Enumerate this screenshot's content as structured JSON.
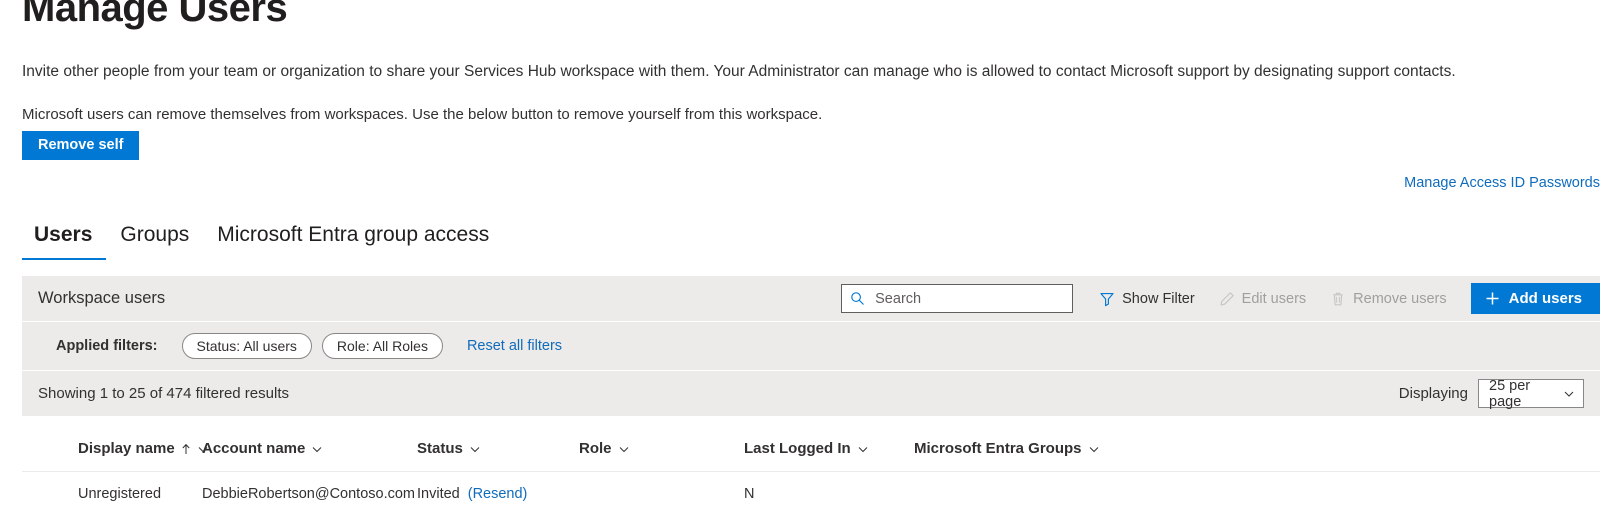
{
  "page": {
    "title": "Manage Users",
    "intro_line_1": "Invite other people from your team or organization to share your Services Hub workspace with them. Your Administrator can manage who is allowed to contact Microsoft support by designating support contacts.",
    "intro_line_2": "Microsoft users can remove themselves from workspaces. Use the below button to remove yourself from this workspace.",
    "remove_self_label": "Remove self",
    "access_link_label": "Manage Access ID Passwords"
  },
  "tabs": [
    {
      "label": "Users",
      "active": true
    },
    {
      "label": "Groups",
      "active": false
    },
    {
      "label": "Microsoft Entra group access",
      "active": false
    }
  ],
  "toolbar": {
    "heading": "Workspace users",
    "search_placeholder": "Search",
    "search_value": "",
    "show_filter_label": "Show Filter",
    "edit_users_label": "Edit users",
    "remove_users_label": "Remove users",
    "add_users_label": "Add users"
  },
  "filters": {
    "label": "Applied filters:",
    "pills": [
      {
        "label": "Status: All users"
      },
      {
        "label": "Role: All Roles"
      }
    ],
    "reset_label": "Reset all filters"
  },
  "results": {
    "showing_text": "Showing 1 to 25 of 474 filtered results",
    "displaying_label": "Displaying",
    "per_page_value": "25 per page"
  },
  "table": {
    "columns": [
      {
        "label": "Display name",
        "sorted": "asc"
      },
      {
        "label": "Account name",
        "sorted": ""
      },
      {
        "label": "Status",
        "sorted": ""
      },
      {
        "label": "Role",
        "sorted": ""
      },
      {
        "label": "Last Logged In",
        "sorted": ""
      },
      {
        "label": "Microsoft Entra Groups",
        "sorted": ""
      }
    ],
    "rows": [
      {
        "display_name": "Unregistered",
        "account_name": "DebbieRobertson@Contoso.com",
        "status": "Invited",
        "status_action": "(Resend)",
        "role": "",
        "last_logged_in": "N",
        "entra_groups": ""
      }
    ]
  },
  "colors": {
    "accent": "#0078d4",
    "link": "#0f6cbd",
    "panel_bg": "#edebe9",
    "text": "#323130",
    "disabled": "#a19f9d"
  }
}
